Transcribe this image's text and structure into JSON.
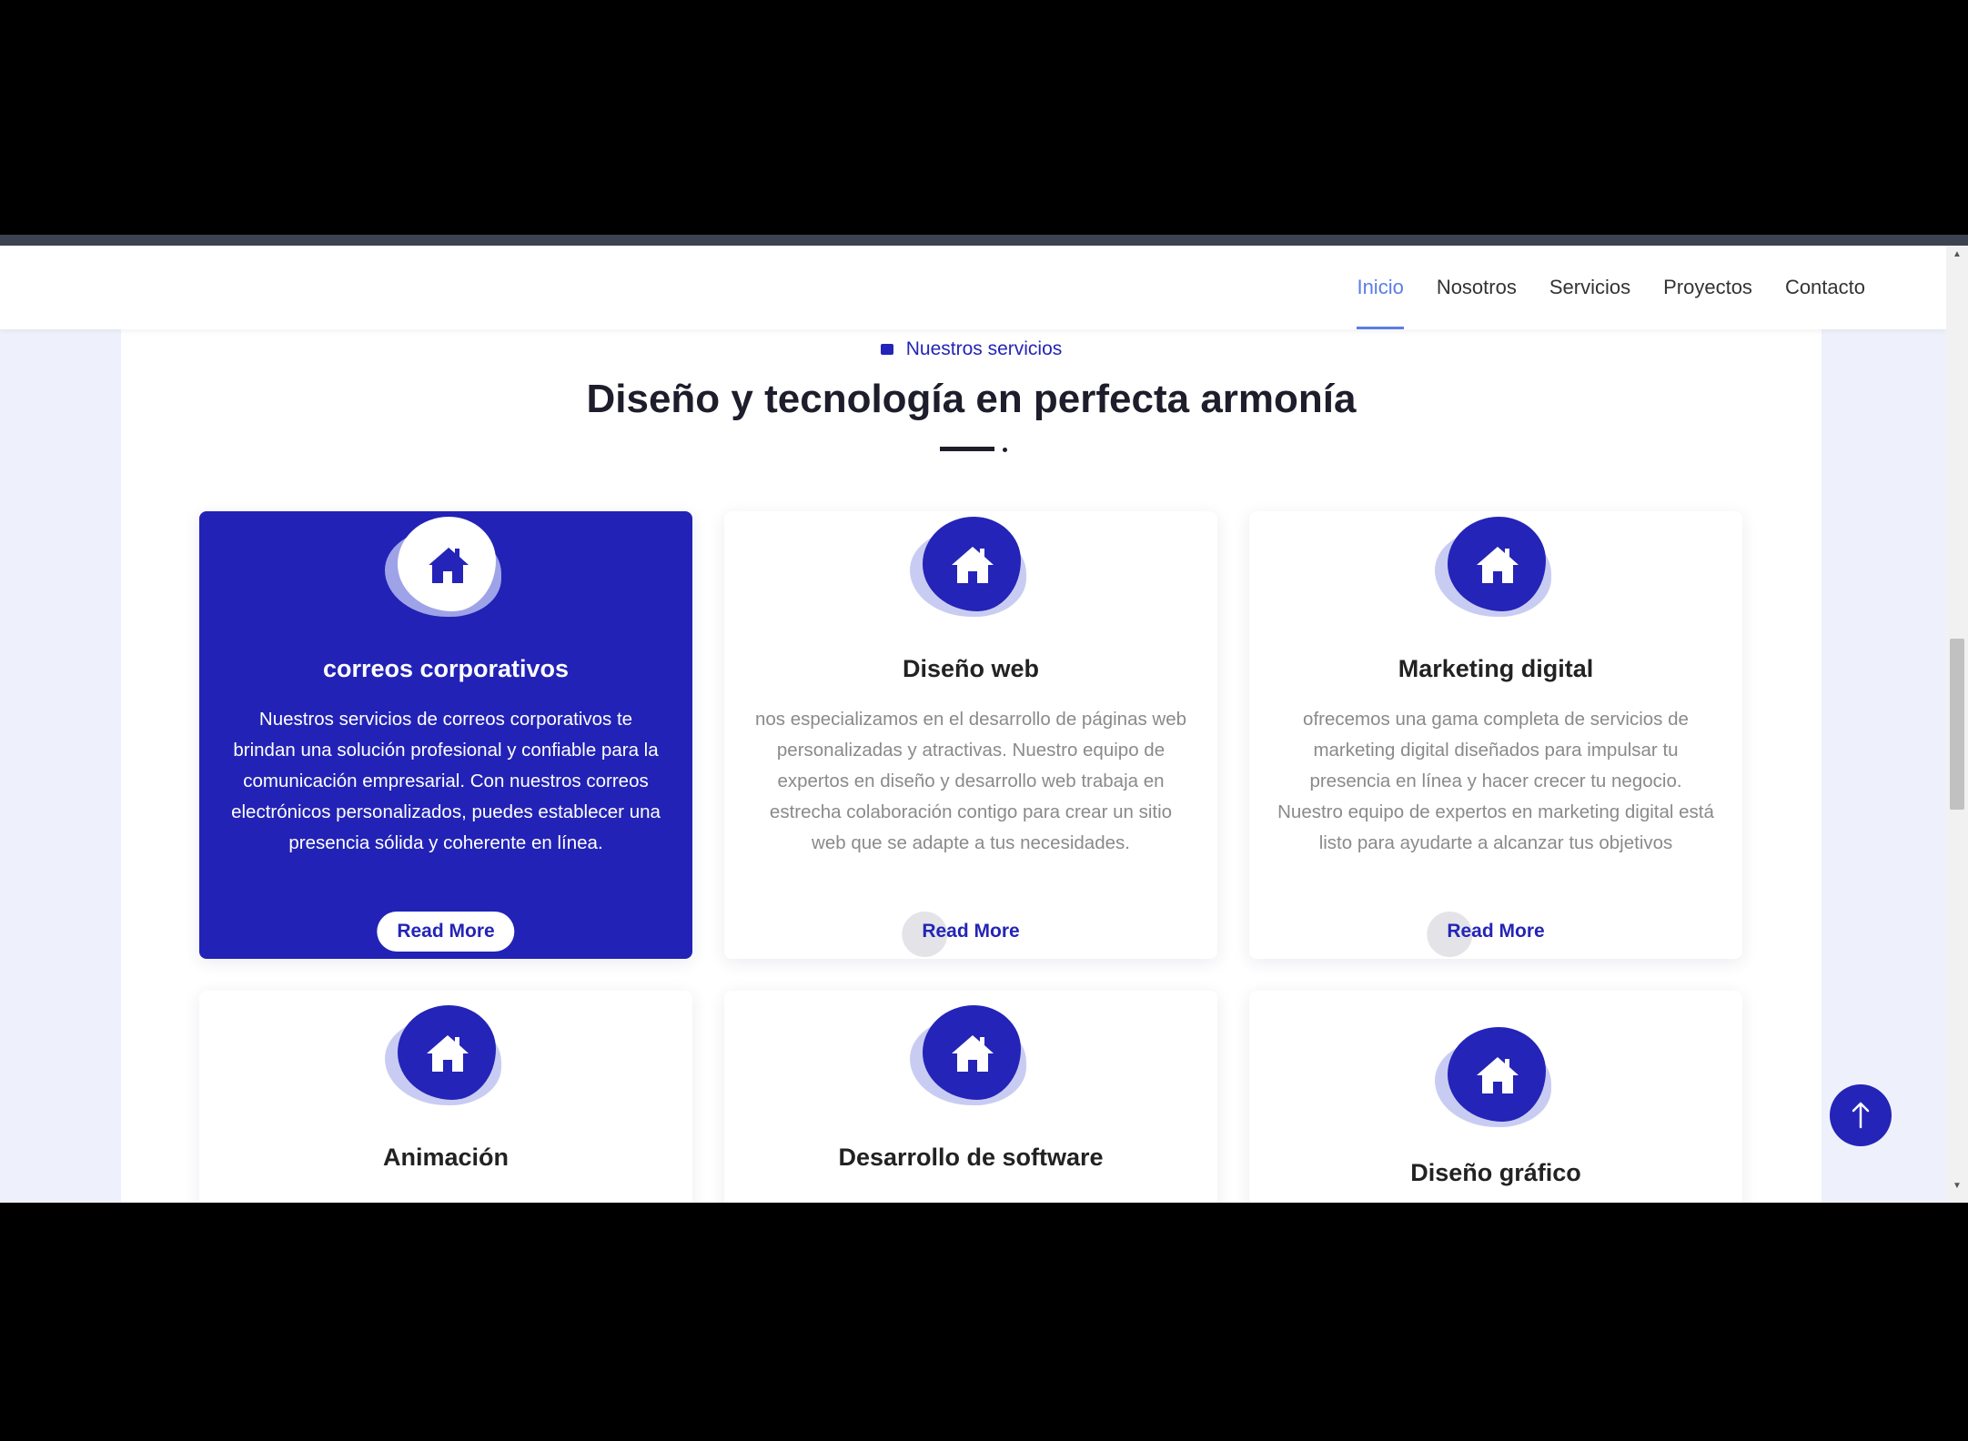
{
  "nav": {
    "items": [
      {
        "label": "Inicio",
        "active": true
      },
      {
        "label": "Nosotros",
        "active": false
      },
      {
        "label": "Servicios",
        "active": false
      },
      {
        "label": "Proyectos",
        "active": false
      },
      {
        "label": "Contacto",
        "active": false
      }
    ]
  },
  "section": {
    "eyebrow": "Nuestros servicios",
    "title": "Diseño y tecnología en perfecta armonía"
  },
  "services": [
    {
      "icon": "home-icon",
      "title": "correos corporativos",
      "text": "Nuestros servicios de correos corporativos te brindan una solución profesional y confiable para la comunicación empresarial. Con nuestros correos electrónicos personalizados, puedes establecer una presencia sólida y coherente en línea.",
      "button": "Read More",
      "active": true
    },
    {
      "icon": "home-icon",
      "title": "Diseño web",
      "text": "nos especializamos en el desarrollo de páginas web personalizadas y atractivas. Nuestro equipo de expertos en diseño y desarrollo web trabaja en estrecha colaboración contigo para crear un sitio web que se adapte a tus necesidades.",
      "button": "Read More",
      "active": false
    },
    {
      "icon": "home-icon",
      "title": "Marketing digital",
      "text": "ofrecemos una gama completa de servicios de marketing digital diseñados para impulsar tu presencia en línea y hacer crecer tu negocio. Nuestro equipo de expertos en marketing digital está listo para ayudarte a alcanzar tus objetivos",
      "button": "Read More",
      "active": false
    },
    {
      "icon": "home-icon",
      "title": "Animación",
      "active": false
    },
    {
      "icon": "home-icon",
      "title": "Desarrollo de software",
      "active": false
    },
    {
      "icon": "home-icon",
      "title": "Diseño gráfico",
      "active": false
    }
  ],
  "colors": {
    "accent": "#2424b8",
    "nav_active": "#5b7de8",
    "page_bg": "#eef1fb"
  }
}
